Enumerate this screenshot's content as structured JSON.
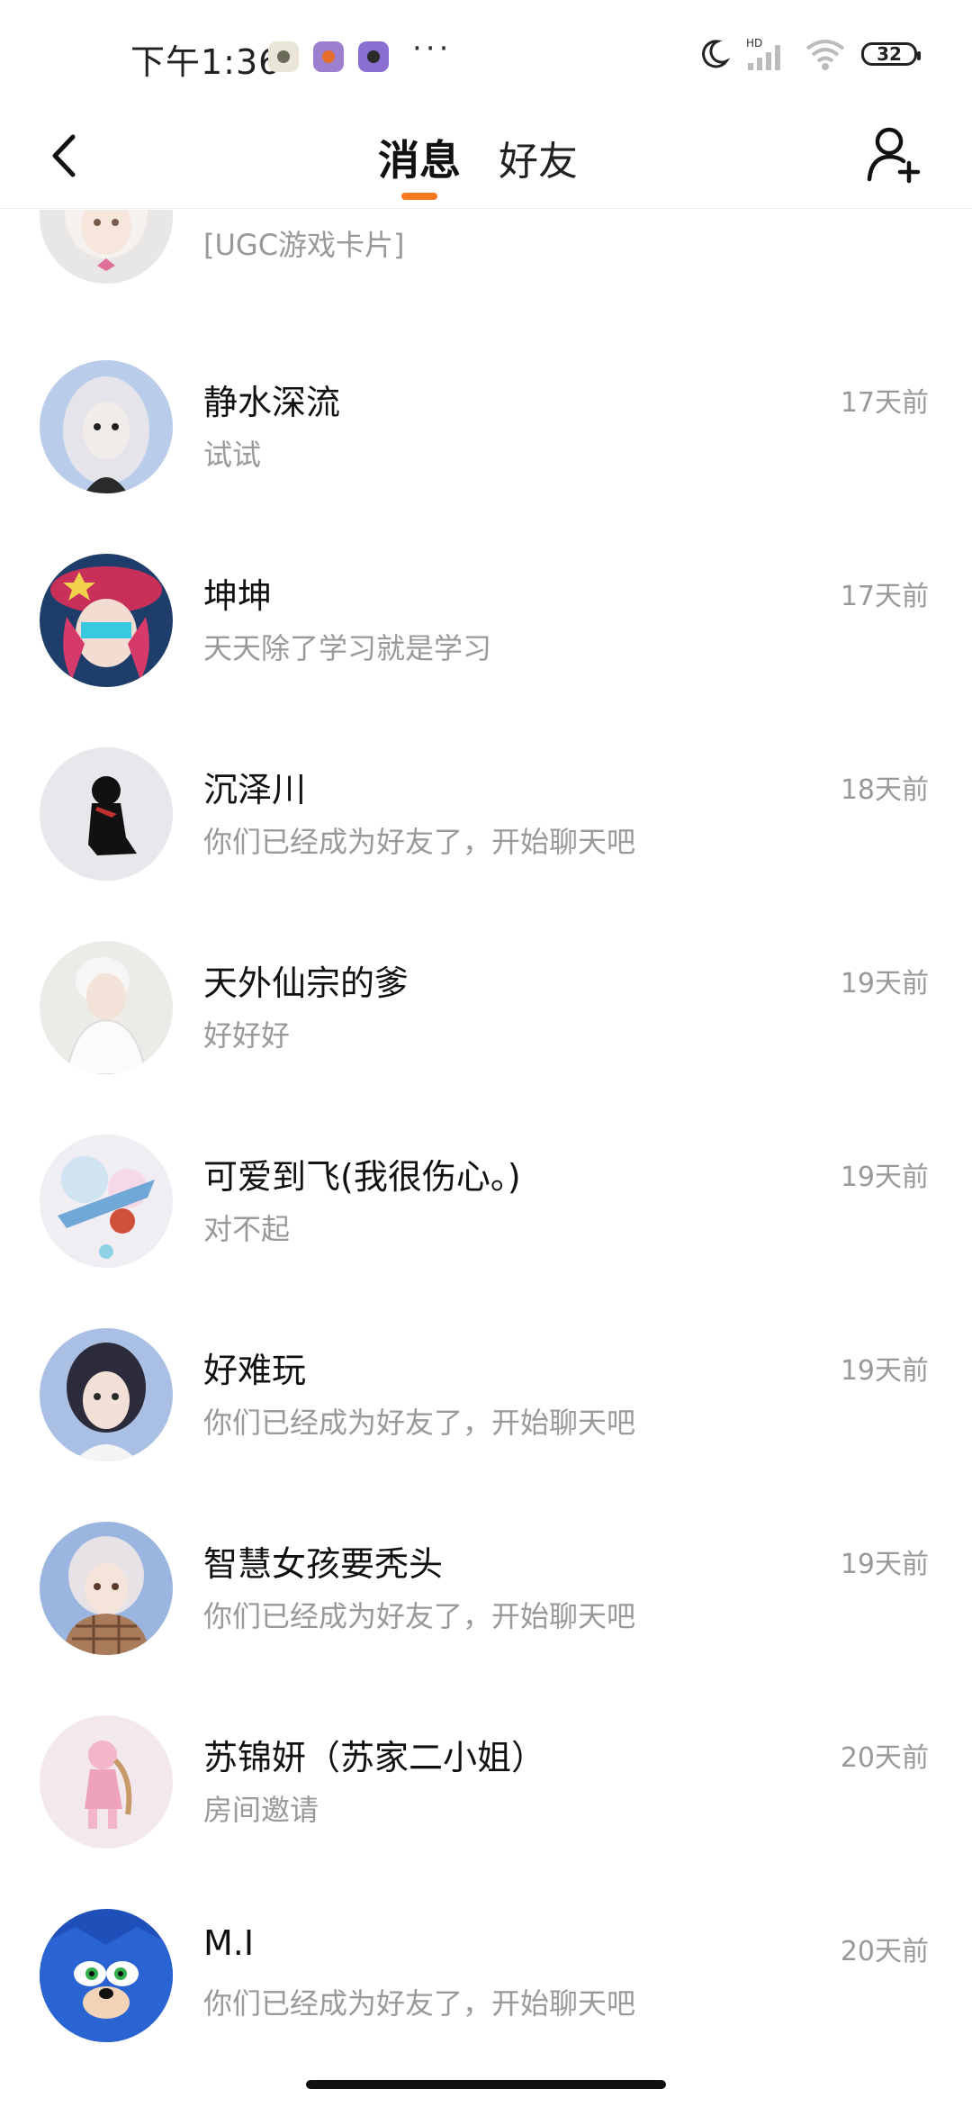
{
  "status_bar": {
    "time": "下午1:36",
    "more": "···",
    "hd": "HD",
    "battery": "32",
    "app_icons": [
      {
        "icon": "app-icon-1",
        "bg": "#e9e6d8",
        "dot": "#6b6b5a"
      },
      {
        "icon": "app-icon-2",
        "bg": "#9d7fd0",
        "dot": "#e86d2b"
      },
      {
        "icon": "app-icon-3",
        "bg": "#8a6fd0",
        "dot": "#2b2b2b"
      }
    ]
  },
  "header": {
    "tabs": [
      {
        "label": "消息",
        "active": true
      },
      {
        "label": "好友",
        "active": false
      }
    ],
    "accent": "#f57a1f"
  },
  "messages": [
    {
      "name": "",
      "preview": "[UGC游戏卡片]",
      "time": "",
      "avatar": "white-hair-girl-avatar"
    },
    {
      "name": "静水深流",
      "preview": "试试",
      "time": "17天前",
      "avatar": "silver-hair-avatar"
    },
    {
      "name": "坤坤",
      "preview": "天天除了学习就是学习",
      "time": "17天前",
      "avatar": "pink-hat-avatar"
    },
    {
      "name": "沉泽川",
      "preview": "你们已经成为好友了，开始聊天吧",
      "time": "18天前",
      "avatar": "black-figure-avatar"
    },
    {
      "name": "天外仙宗的爹",
      "preview": "好好好",
      "time": "19天前",
      "avatar": "white-robe-avatar"
    },
    {
      "name": "可爱到飞(我很伤心。)",
      "preview": "对不起",
      "time": "19天前",
      "avatar": "colorful-avatar"
    },
    {
      "name": "好难玩",
      "preview": "你们已经成为好友了，开始聊天吧",
      "time": "19天前",
      "avatar": "dark-hair-avatar"
    },
    {
      "name": "智慧女孩要秃头",
      "preview": "你们已经成为好友了，开始聊天吧",
      "time": "19天前",
      "avatar": "plaid-scarf-avatar"
    },
    {
      "name": "苏锦妍（苏家二小姐）",
      "preview": "房间邀请",
      "time": "20天前",
      "avatar": "pink-doll-avatar"
    },
    {
      "name": "M.I",
      "preview": "你们已经成为好友了，开始聊天吧",
      "time": "20天前",
      "avatar": "blue-hedgehog-avatar"
    }
  ]
}
